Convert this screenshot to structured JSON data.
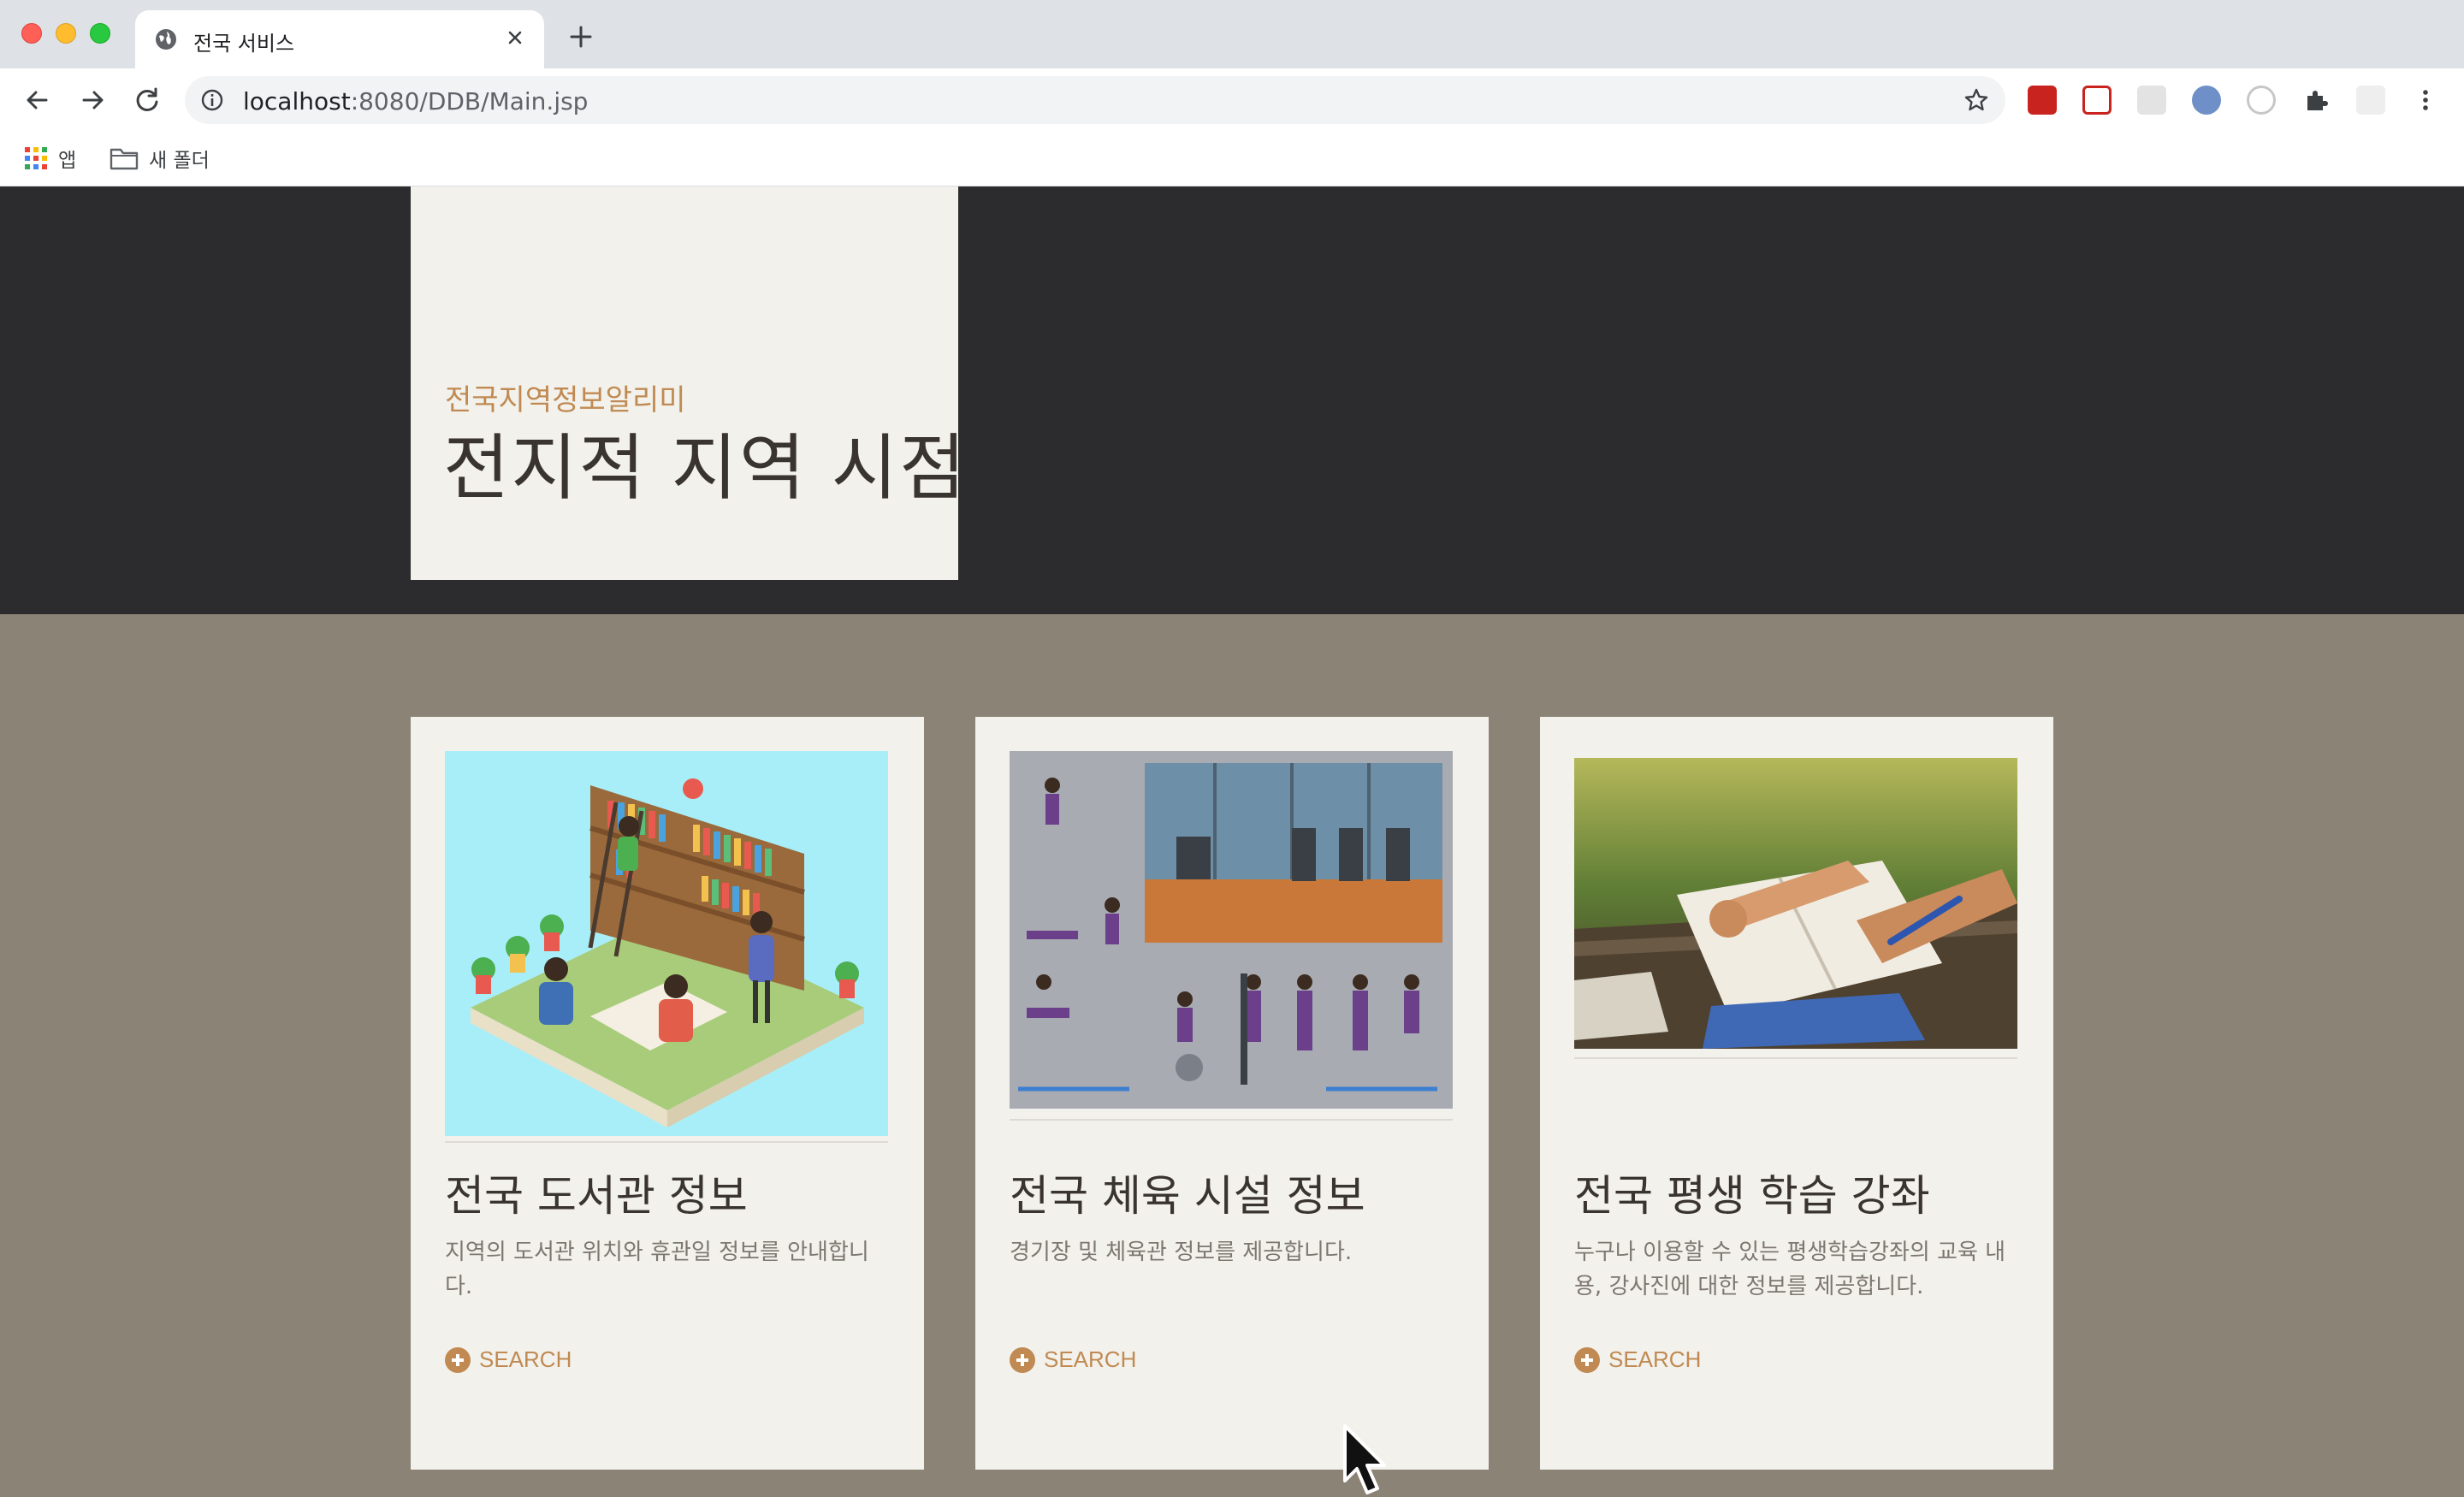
{
  "browser": {
    "tab_title": "전국 서비스",
    "url_host": "localhost",
    "url_rest": ":8080/DDB/Main.jsp",
    "bookmarks": [
      {
        "label": "앱",
        "icon": "apps-grid-icon"
      },
      {
        "label": "새 폴더",
        "icon": "folder-icon"
      }
    ]
  },
  "hero": {
    "subtitle": "전국지역정보알리미",
    "title": "전지적 지역 시점"
  },
  "cards": [
    {
      "title": "전국 도서관 정보",
      "description": "지역의 도서관 위치와 휴관일 정보를 안내합니다.",
      "link": "SEARCH",
      "image": "library-illustration"
    },
    {
      "title": "전국 체육 시설 정보",
      "description": "경기장 및 체육관 정보를 제공합니다.",
      "link": "SEARCH",
      "image": "fitness-collage"
    },
    {
      "title": "전국 평생 학습 강좌",
      "description": "누구나 이용할 수 있는 평생학습강좌의 교육 내용, 강사진에 대한 정보를 제공합니다.",
      "link": "SEARCH",
      "image": "studying-hands-photo"
    }
  ],
  "colors": {
    "hero_bg": "#2c2c2e",
    "page_bg": "#8b8376",
    "panel_bg": "#f2f1ec",
    "accent": "#c08a52",
    "title_text": "#3a3430"
  }
}
